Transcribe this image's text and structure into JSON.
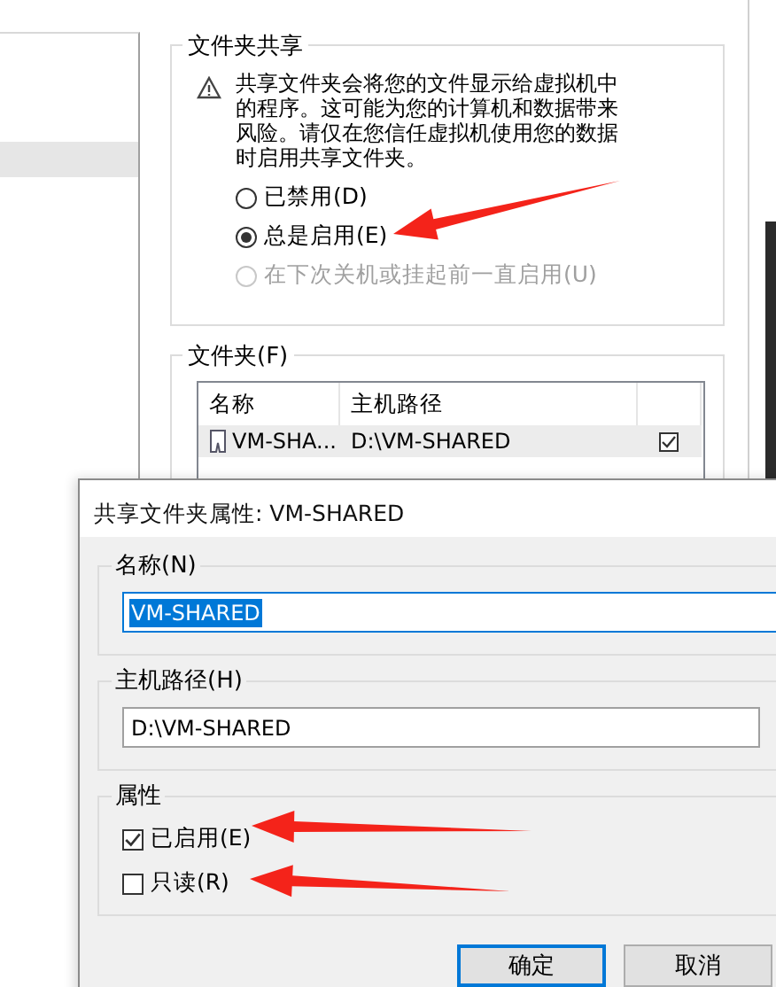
{
  "sidebar": {
    "rows": [
      {
        "selected": true
      }
    ]
  },
  "sharing_group": {
    "title": "文件夹共享",
    "warning": "共享文件夹会将您的文件显示给虚拟机中的程序。这可能为您的计算机和数据带来风险。请仅在您信任虚拟机使用您的数据时启用共享文件夹。",
    "options": [
      {
        "label": "已禁用(D)",
        "selected": false,
        "disabled": false
      },
      {
        "label": "总是启用(E)",
        "selected": true,
        "disabled": false
      },
      {
        "label": "在下次关机或挂起前一直启用(U)",
        "selected": false,
        "disabled": true
      }
    ]
  },
  "folders_group": {
    "title": "文件夹(F)",
    "columns": [
      "名称",
      "主机路径"
    ],
    "rows": [
      {
        "name": "VM-SHA...",
        "path": "D:\\VM-SHARED",
        "checked": true
      }
    ]
  },
  "dialog": {
    "title": "共享文件夹属性: VM-SHARED",
    "name_group": {
      "label": "名称(N)",
      "value": "VM-SHARED",
      "focused": true
    },
    "path_group": {
      "label": "主机路径(H)",
      "value": "D:\\VM-SHARED",
      "focused": false
    },
    "attributes_group": {
      "label": "属性",
      "checkboxes": [
        {
          "label": "已启用(E)",
          "checked": true
        },
        {
          "label": "只读(R)",
          "checked": false
        }
      ]
    },
    "buttons": [
      {
        "label": "确定",
        "default": true
      },
      {
        "label": "取消",
        "default": false
      }
    ]
  },
  "annotations": [
    {
      "kind": "arrow"
    },
    {
      "kind": "arrow"
    },
    {
      "kind": "arrow"
    }
  ]
}
